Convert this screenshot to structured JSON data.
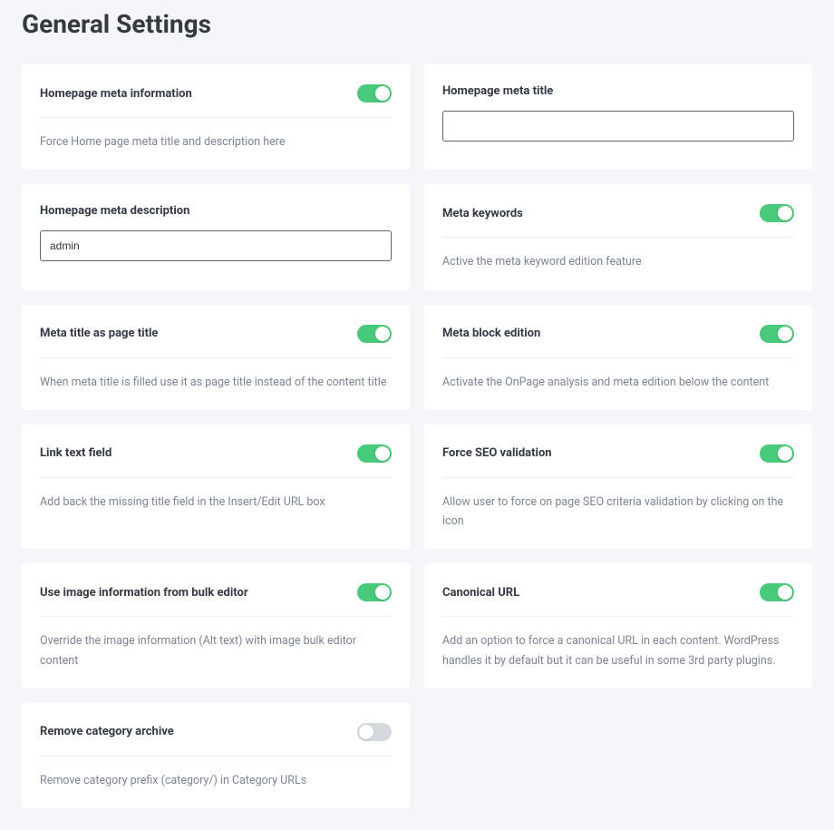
{
  "page_title": "General Settings",
  "cards": {
    "homepage_meta_info": {
      "title": "Homepage meta information",
      "desc": "Force Home page meta title and description here",
      "toggle": true
    },
    "homepage_meta_title": {
      "title": "Homepage meta title",
      "value": ""
    },
    "homepage_meta_desc": {
      "title": "Homepage meta description",
      "value": "admin"
    },
    "meta_keywords": {
      "title": "Meta keywords",
      "desc": "Active the meta keyword edition feature",
      "toggle": true
    },
    "meta_title_as_page_title": {
      "title": "Meta title as page title",
      "desc": "When meta title is filled use it as page title instead of the content title",
      "toggle": true
    },
    "meta_block_edition": {
      "title": "Meta block edition",
      "desc": "Activate the OnPage analysis and meta edition below the content",
      "toggle": true
    },
    "link_text_field": {
      "title": "Link text field",
      "desc": "Add back the missing title field in the Insert/Edit URL box",
      "toggle": true
    },
    "force_seo_validation": {
      "title": "Force SEO validation",
      "desc": "Allow user to force on page SEO criteria validation by clicking on the icon",
      "toggle": true
    },
    "use_image_info_bulk": {
      "title": "Use image information from bulk editor",
      "desc": "Override the image information (Alt text) with image bulk editor content",
      "toggle": true
    },
    "canonical_url": {
      "title": "Canonical URL",
      "desc": "Add an option to force a canonical URL in each content. WordPress handles it by default but it can be useful in some 3rd party plugins.",
      "toggle": true
    },
    "remove_category_archive": {
      "title": "Remove category archive",
      "desc": "Remove category prefix (category/) in Category URLs",
      "toggle": false
    }
  }
}
